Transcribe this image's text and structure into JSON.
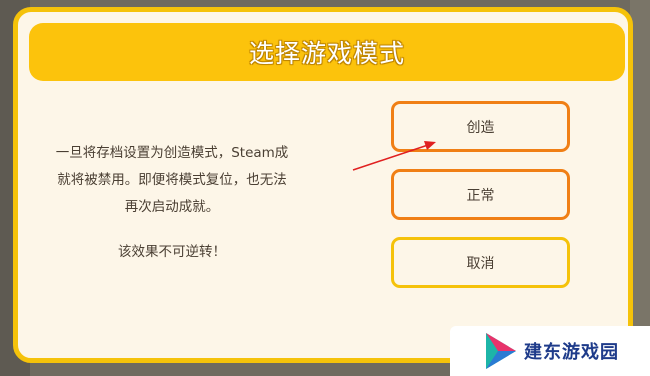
{
  "dialog": {
    "title": "选择游戏模式",
    "message_lines": [
      "一旦将存档设置为创造模式，Steam成",
      "就将被禁用。即便将模式复位，也无法",
      "再次启动成就。"
    ],
    "warning": "该效果不可逆转！"
  },
  "buttons": {
    "create": "创造",
    "normal": "正常",
    "cancel": "取消"
  },
  "watermark": {
    "text": "建东游戏园",
    "logo": "play-triangle-logo"
  },
  "colors": {
    "title_bar": "#fcc30c",
    "dialog_border": "#f5c20a",
    "dialog_bg": "#fdf6e8",
    "primary_border": "#f07f15",
    "cancel_border": "#f5c20a",
    "arrow": "#e02020",
    "watermark_text": "#1e3b8a"
  }
}
